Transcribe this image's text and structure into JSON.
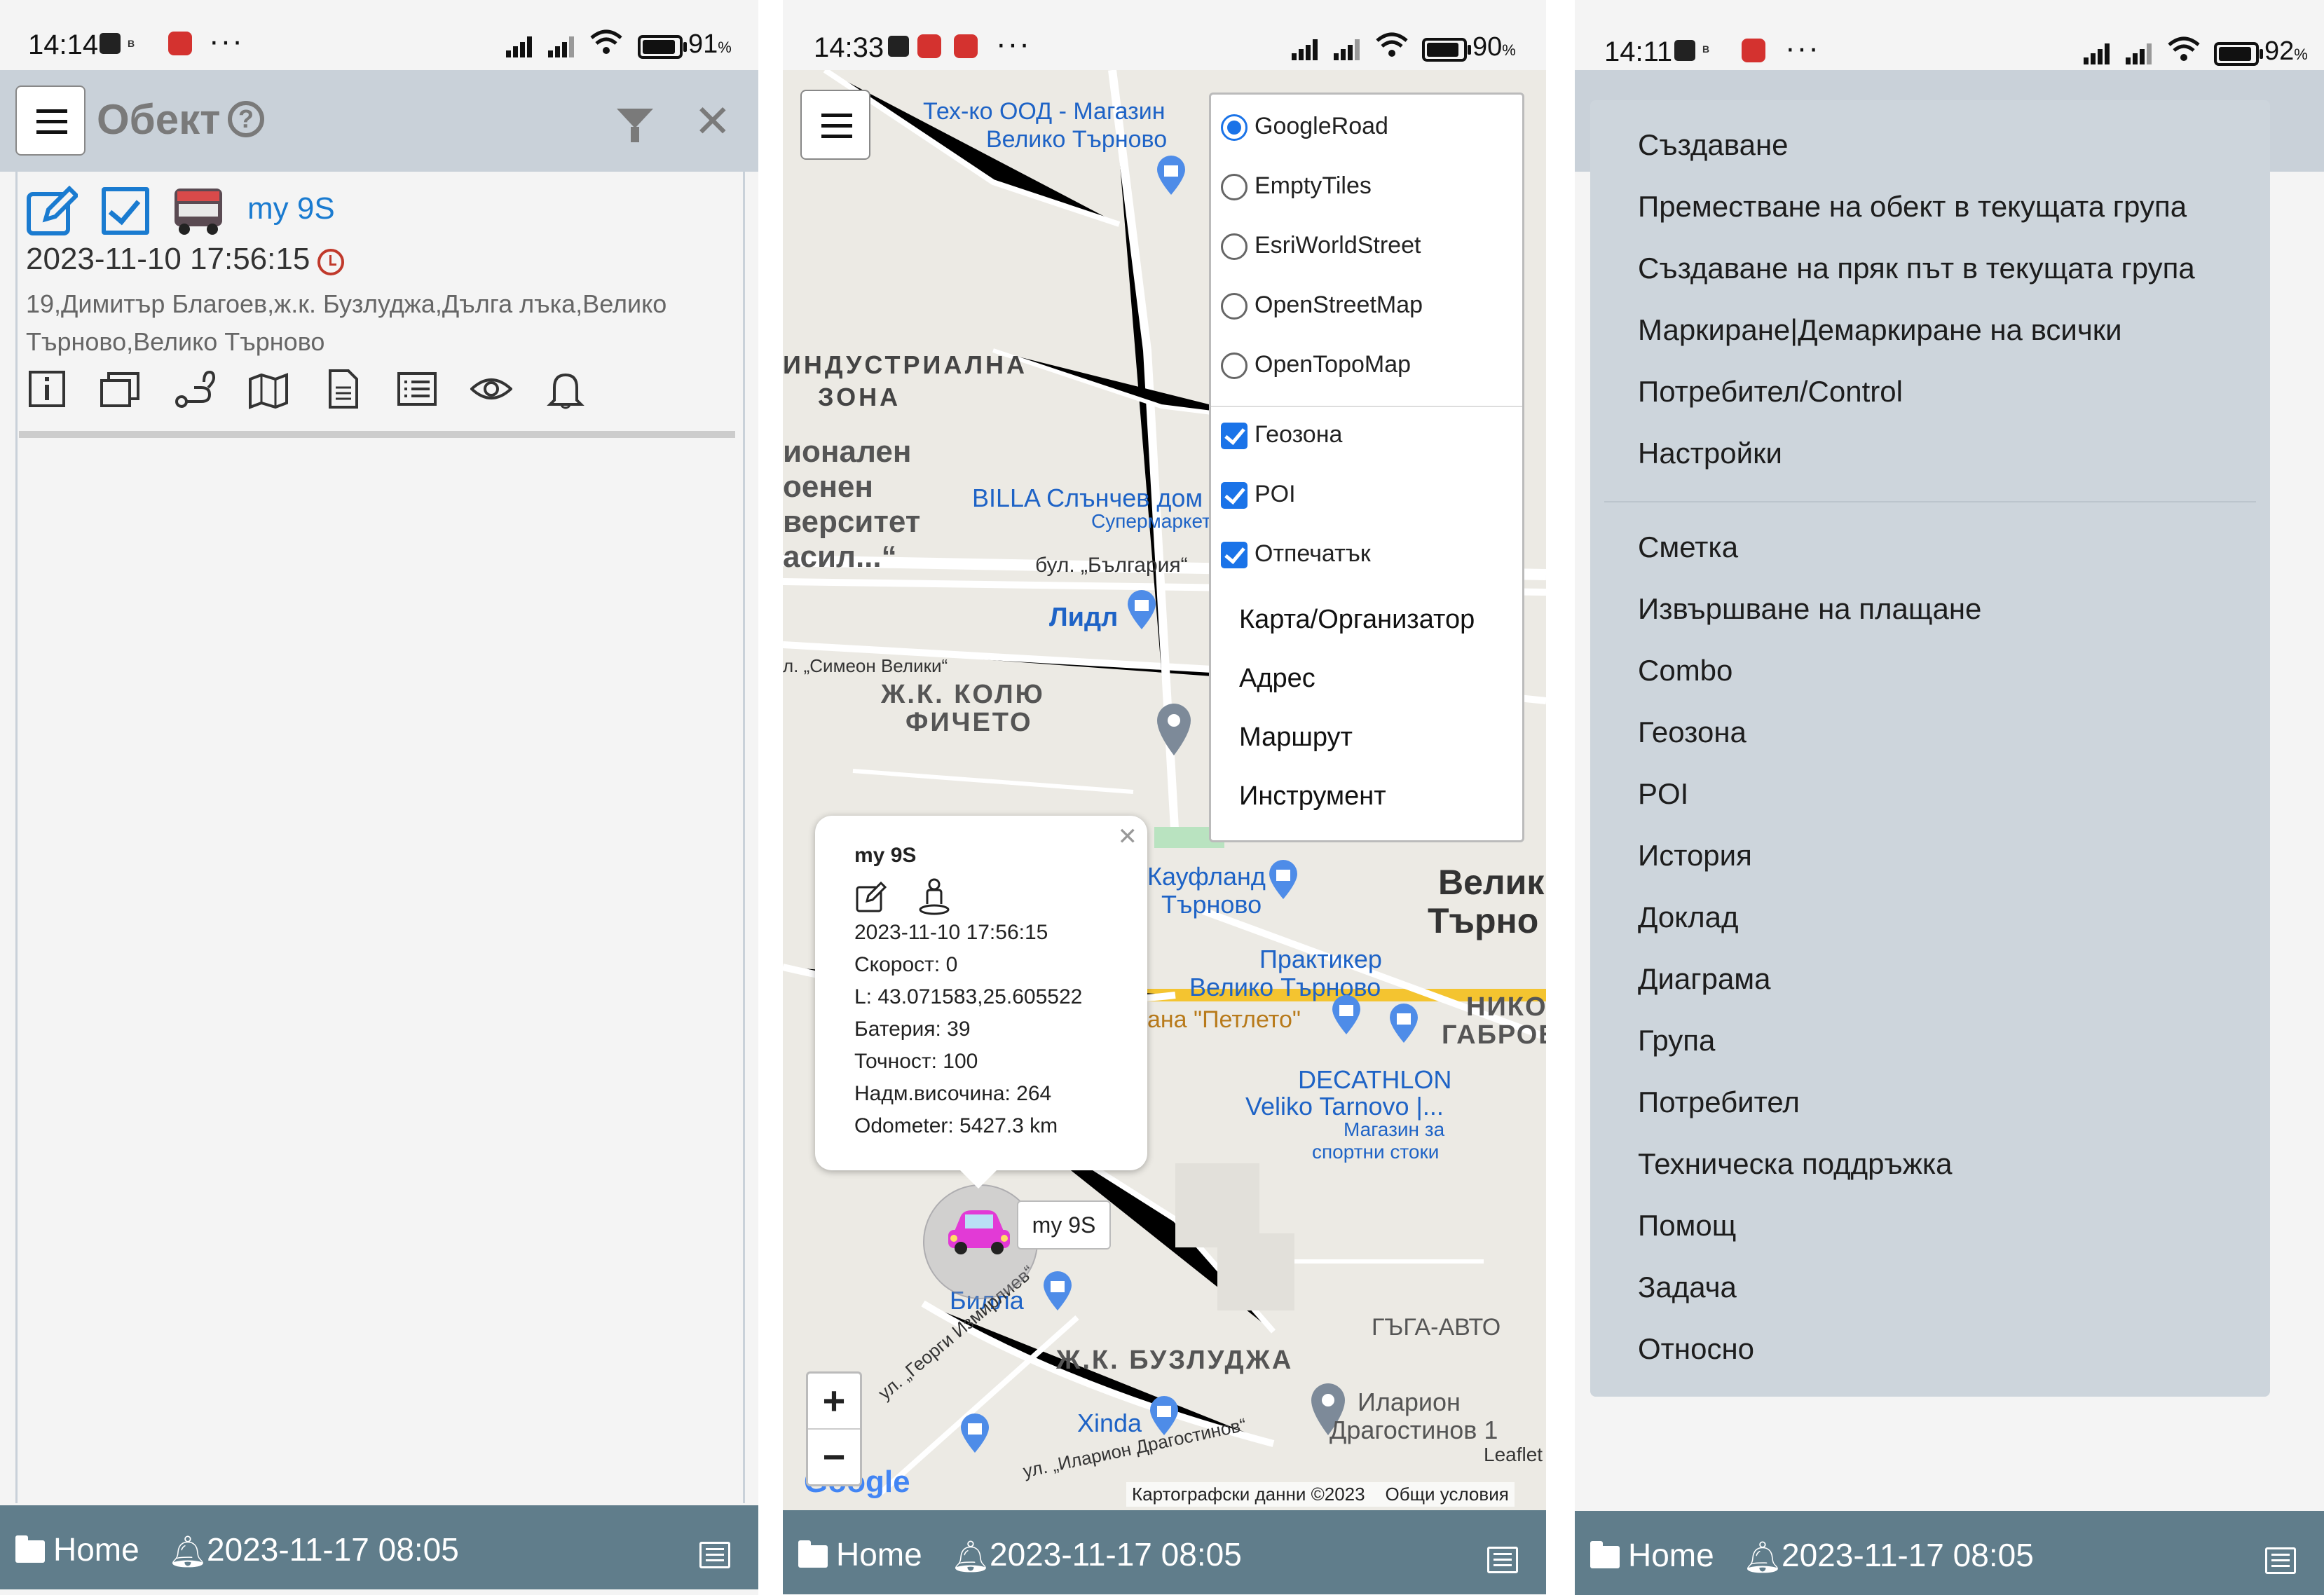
{
  "panel1": {
    "status": {
      "time": "14:14",
      "battery_pct": "91",
      "battery_unit": "%",
      "battery_level": 0.91
    },
    "header": {
      "title": "Обект"
    },
    "object": {
      "name": "my 9S",
      "datetime": "2023-11-10 17:56:15",
      "address": "19,Димитър Благоев,ж.к. Бузлуджа,Дълга лъка,Велико Търново,Велико Търново"
    },
    "bottom": {
      "home": "Home",
      "datetime": "2023-11-17 08:05"
    }
  },
  "panel2": {
    "status": {
      "time": "14:33",
      "battery_pct": "90",
      "battery_unit": "%",
      "battery_level": 0.9
    },
    "layers": {
      "base": [
        "GoogleRoad",
        "EmptyTiles",
        "EsriWorldStreet",
        "OpenStreetMap",
        "OpenTopoMap"
      ],
      "selected": "GoogleRoad",
      "overlays": [
        "Геозона",
        "POI",
        "Отпечатък"
      ],
      "links": [
        "Карта/Организатор",
        "Адрес",
        "Маршрут",
        "Инструмент"
      ]
    },
    "popup": {
      "name": "my 9S",
      "lines": [
        "2023-11-10 17:56:15",
        "Скорост: 0",
        "L: 43.071583,25.605522",
        "Батерия: 39",
        "Точност: 100",
        "Надм.височина: 264",
        "Odometer: 5427.3 km"
      ]
    },
    "marker_label": "my 9S",
    "zoom": {
      "in": "+",
      "out": "−"
    },
    "attribution": {
      "map_data": "Картографски данни ©2023",
      "terms": "Общи условия",
      "leaflet": "Leaflet",
      "google": "Google"
    },
    "map_labels": {
      "shop1": "Тех-ко ООД - Магазин",
      "shop1b": "Велико Търново",
      "zone1": "ИНДУСТРИАЛНА",
      "zone1b": "ЗОНА",
      "uni1": "ионален",
      "uni2": "оенен",
      "uni3": "верситет",
      "uni4": "асил...“",
      "billa1": "BILLA Слънчев дом",
      "billa1b": "Супермаркет",
      "street1": "бул. „България“",
      "lidl": "Лидл",
      "street2": "л. „Симеон Велики“",
      "district1": "Ж.К. КОЛЮ",
      "district1b": "ФИЧЕТО",
      "kaufland": "Кауфланд",
      "kaufland_b": "Търново",
      "city1": "Велик",
      "city1b": "Търно",
      "praktiker": "Практикер",
      "praktiker_b": "Велико Търново",
      "petleto": "ана \"Петлето\"",
      "nik1": "НИКО",
      "nik2": "ГАБРОВ",
      "decathlon": "DECATHLON",
      "decathlon_b": "Veliko Tarnovo |...",
      "decathlon_c": "Магазин за",
      "decathlon_d": "спортни стоки",
      "billa2": "Билла",
      "gaga": "ГЪГА-АВТО",
      "district2": "Ж.К. БУЗЛУДЖА",
      "street3": "ул. „Георги Измирлиев“",
      "xinda": "Xinda",
      "ilarion": "Иларион",
      "ilarion_b": "Драгостинов 1",
      "street4": "ул. „Иларион Драгостинов“"
    },
    "bottom": {
      "home": "Home",
      "datetime": "2023-11-17 08:05"
    }
  },
  "panel3": {
    "status": {
      "time": "14:11",
      "battery_pct": "92",
      "battery_unit": "%",
      "battery_level": 0.92
    },
    "menu_group1": [
      "Създаване",
      "Преместване на обект в текущата група",
      "Създаване на пряк път в текущата група",
      "Маркиране|Демаркиране на всички",
      "Потребител/Control",
      "Настройки"
    ],
    "menu_group2": [
      "Сметка",
      "Извършване на плащане",
      "Combo",
      "Геозона",
      "POI",
      "История",
      "Доклад",
      "Диаграма",
      "Група",
      "Потребител",
      "Техническа поддръжка",
      "Помощ",
      "Задача",
      "Относно"
    ],
    "bottom": {
      "home": "Home",
      "datetime": "2023-11-17 08:05"
    }
  }
}
